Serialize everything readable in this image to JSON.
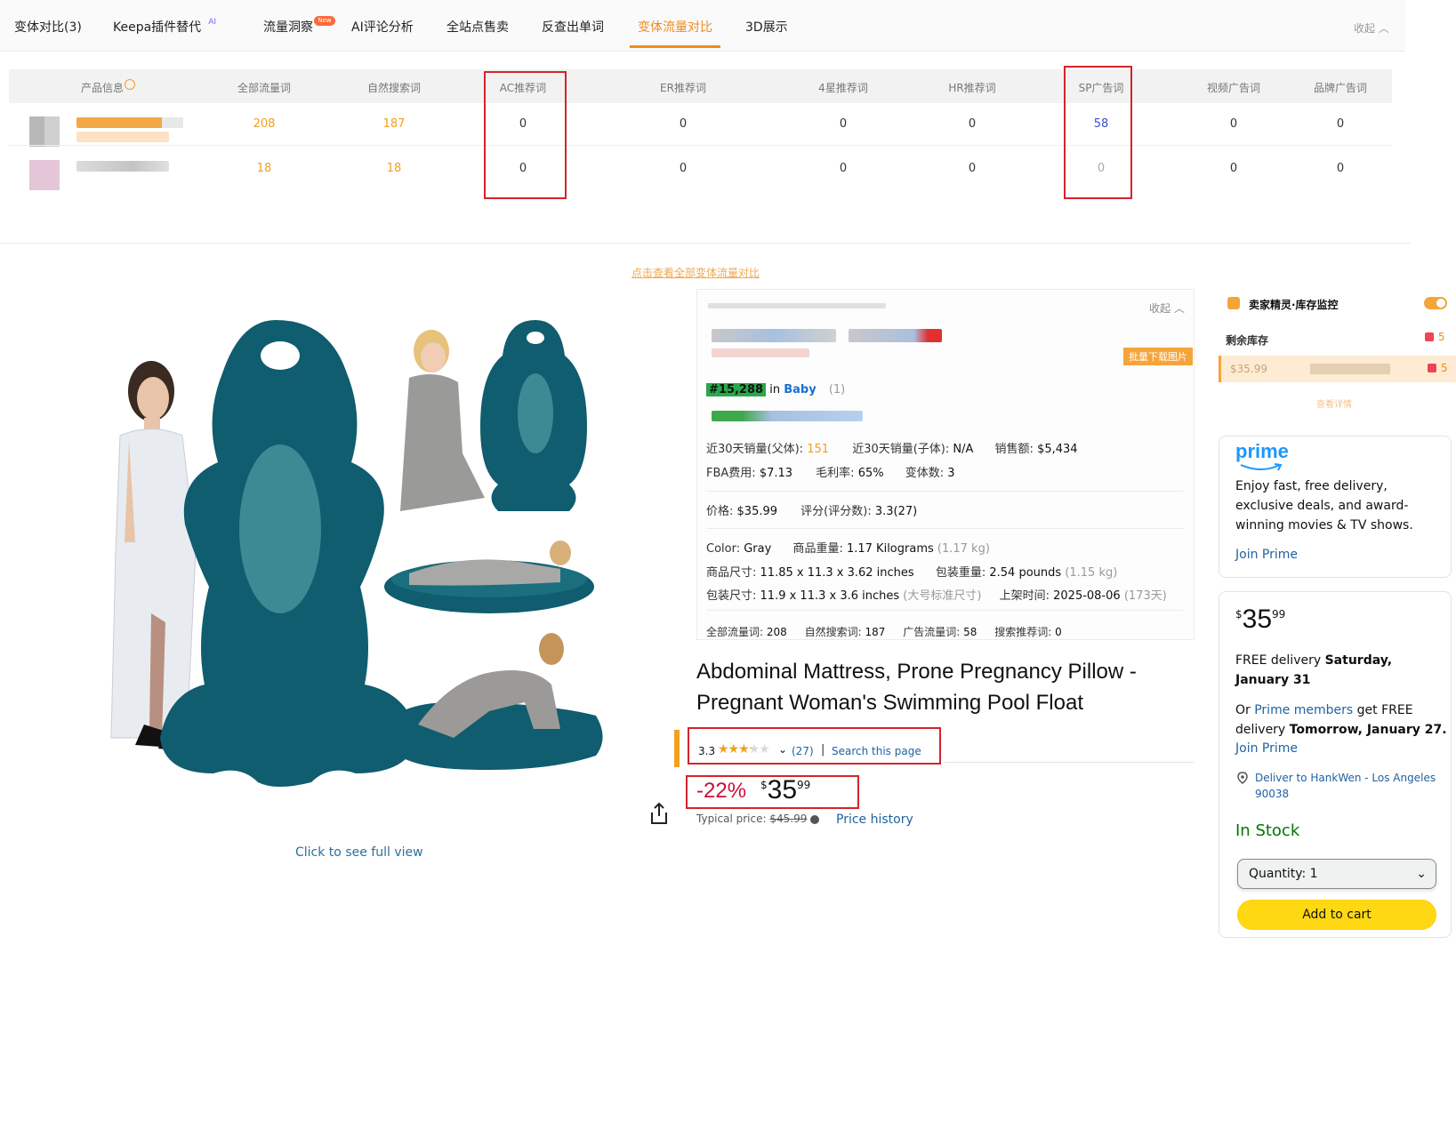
{
  "tabs": [
    {
      "label": "变体对比(3)"
    },
    {
      "label": "Keepa插件替代",
      "sup": "AI"
    },
    {
      "label": "流量洞察",
      "badge": "New"
    },
    {
      "label": "AI评论分析"
    },
    {
      "label": "全站点售卖"
    },
    {
      "label": "反查出单词"
    },
    {
      "label": "变体流量对比",
      "active": true
    },
    {
      "label": "3D展示"
    }
  ],
  "collapse_label": "收起",
  "flow_table": {
    "headers": [
      "产品信息",
      "全部流量词",
      "自然搜索词",
      "AC推荐词",
      "ER推荐词",
      "4星推荐词",
      "HR推荐词",
      "SP广告词",
      "视频广告词",
      "品牌广告词"
    ],
    "rows": [
      [
        "208",
        "187",
        "0",
        "0",
        "0",
        "0",
        "58",
        "0",
        "0"
      ],
      [
        "18",
        "18",
        "0",
        "0",
        "0",
        "0",
        "0",
        "0",
        "0"
      ]
    ],
    "view_all": "点击查看全部变体流量对比"
  },
  "gallery": {
    "link": "Click to see full view"
  },
  "info_card": {
    "collapse": "收起",
    "badge": "批量下载图片",
    "rank": "#15,288",
    "rank_in": "in",
    "rank_category": "Baby",
    "rank_more": "(1)",
    "sales_parent_label": "近30天销量(父体):",
    "sales_parent_value": "151",
    "sales_child_label": "近30天销量(子体):",
    "sales_child_value": "N/A",
    "revenue_label": "销售额:",
    "revenue_value": "$5,434",
    "fba_label": "FBA费用:",
    "fba_value": "$7.13",
    "margin_label": "毛利率:",
    "margin_value": "65%",
    "variants_label": "变体数:",
    "variants_value": "3",
    "price_label": "价格:",
    "price_value": "$35.99",
    "rating_label": "评分(评分数):",
    "rating_value": "3.3(27)",
    "color_label": "Color:",
    "color_value": "Gray",
    "weight_label": "商品重量:",
    "weight_value": "1.17 Kilograms",
    "weight_alt": "(1.17 kg)",
    "size_label": "商品尺寸:",
    "size_value": "11.85 x 11.3 x 3.62 inches",
    "pkg_weight_label": "包装重量:",
    "pkg_weight_value": "2.54 pounds",
    "pkg_weight_alt": "(1.15 kg)",
    "pkg_size_label": "包装尺寸:",
    "pkg_size_value": "11.9 x 11.3 x 3.6 inches",
    "pkg_size_alt": "(大号标准尺寸)",
    "date_label": "上架时间:",
    "date_value": "2025-08-06",
    "date_alt": "(173天)",
    "all_flow_label": "全部流量词:",
    "all_flow_value": "208",
    "organic_label": "自然搜索词:",
    "organic_value": "187",
    "ad_label": "广告流量词:",
    "ad_value": "58",
    "search_rec_label": "搜索推荐词:",
    "search_rec_value": "0"
  },
  "product": {
    "title": "Abdominal Mattress, Prone Pregnancy Pillow - Pregnant Woman's Swimming Pool Float",
    "rating": "3.3",
    "rating_fraction": 0.66,
    "rating_count": "(27)",
    "search_page": "Search this page",
    "discount": "-22%",
    "currency": "$",
    "price_whole": "35",
    "price_fraction": "99",
    "typical_label": "Typical price:",
    "typical_value": "$45.99",
    "price_history": "Price history"
  },
  "stock_widget": {
    "title": "卖家精灵·库存监控",
    "remaining_label": "剩余库存",
    "count1": "5",
    "row_price": "$35.99",
    "count2": "5",
    "link": "查看详情"
  },
  "prime": {
    "logo": "prime",
    "text": "Enjoy fast, free delivery, exclusive deals, and award-winning movies & TV shows.",
    "join": "Join Prime"
  },
  "buybox": {
    "currency": "$",
    "whole": "35",
    "fraction": "99",
    "free_delivery": "FREE delivery",
    "delivery_date": "Saturday, January 31",
    "or": "Or",
    "prime_members": "Prime members",
    "get_free": "get FREE delivery",
    "fastest": "Tomorrow, January 27.",
    "join": "Join Prime",
    "deliver_to": "Deliver to HankWen - Los Angeles 90038",
    "in_stock": "In Stock",
    "quantity": "Quantity: 1",
    "add_to_cart": "Add to cart"
  },
  "colors": {
    "accent": "#f08b1c",
    "red_box": "#d3242b",
    "teal": "#0f5d6e",
    "add_cart": "#ffd814",
    "in_stock": "#007600"
  }
}
